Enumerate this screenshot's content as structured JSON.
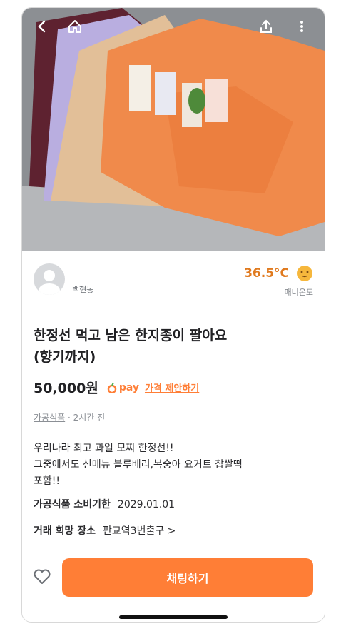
{
  "seller": {
    "name": "백현동",
    "temperature": "36.5°C",
    "manner_label": "매너온도"
  },
  "product": {
    "title_line1": "한정선 먹고 남은 한지종이 팔아요",
    "title_line2": "(향기까지)",
    "price": "50,000원",
    "pay_label": "pay",
    "offer_label": "가격 제안하기",
    "category": "가공식품",
    "time": "· 2시간 전",
    "description": [
      "우리나라 최고 과일 모찌 한정선!!",
      "그중에서도 신메뉴 블루베리,복숭아 요거트 찹쌀떡",
      "포함!!"
    ],
    "expiry_label": "가공식품 소비기한",
    "expiry_value": "2029.01.01",
    "place_label": "거래 희망 장소",
    "place_value": "판교역3번출구 >"
  },
  "actions": {
    "chat_label": "채팅하기"
  },
  "icons": {
    "back": "back-icon",
    "home": "home-icon",
    "share": "share-icon",
    "more": "more-icon",
    "heart": "heart-icon"
  },
  "colors": {
    "accent": "#ff7e36",
    "temperature": "#e07a1f"
  }
}
